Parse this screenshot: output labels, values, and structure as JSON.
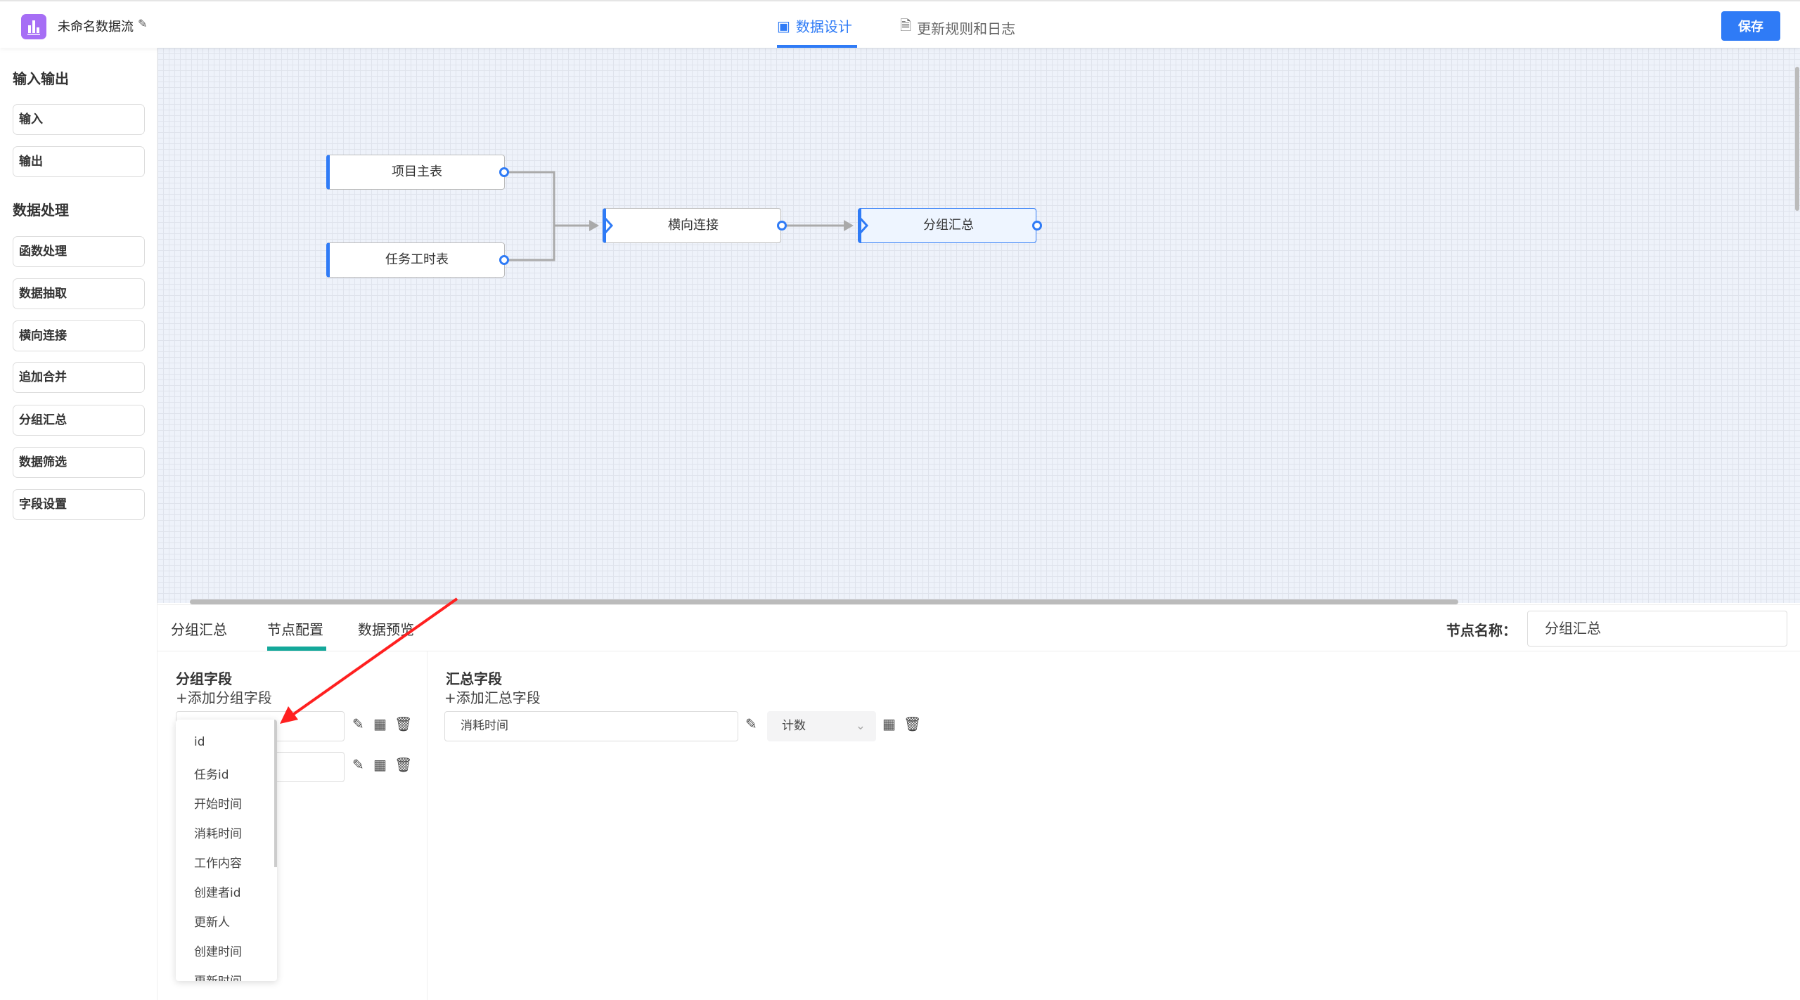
{
  "header": {
    "title": "未命名数据流",
    "tabs": [
      {
        "label": "数据设计",
        "active": true
      },
      {
        "label": "更新规则和日志",
        "active": false
      }
    ],
    "save_label": "保存",
    "accent": "#2f7bf6"
  },
  "sidebar": {
    "sections": [
      {
        "title": "输入输出",
        "items": [
          "输入",
          "输出"
        ]
      },
      {
        "title": "数据处理",
        "items": [
          "函数处理",
          "数据抽取",
          "横向连接",
          "追加合并",
          "分组汇总",
          "数据筛选",
          "字段设置"
        ]
      }
    ]
  },
  "canvas": {
    "nodes": [
      "项目主表",
      "任务工时表",
      "横向连接",
      "分组汇总"
    ],
    "selected": "分组汇总"
  },
  "panel": {
    "tabs": [
      "分组汇总",
      "节点配置",
      "数据预览"
    ],
    "active_tab": "节点配置",
    "node_name_label": "节点名称：",
    "node_name_value": "分组汇总",
    "group": {
      "title": "分组字段",
      "add_label": "+添加分组字段",
      "dropdown_options": [
        "id",
        "任务id",
        "开始时间",
        "消耗时间",
        "工作内容",
        "创建者id",
        "更新人",
        "创建时间",
        "更新时间"
      ]
    },
    "summary": {
      "title": "汇总字段",
      "add_label": "+添加汇总字段",
      "field_value": "消耗时间",
      "agg_value": "计数"
    }
  },
  "annotation_color": "#ff2020"
}
